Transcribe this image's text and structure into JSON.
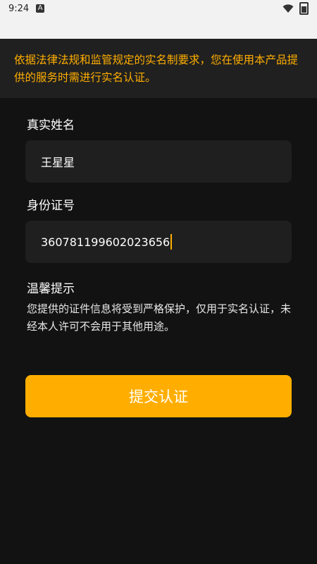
{
  "status_bar": {
    "time": "9:24",
    "notification_icon_letter": "A",
    "icons": [
      "wifi-icon",
      "battery-icon"
    ]
  },
  "notice": {
    "text": "依据法律法规和监管规定的实名制要求，您在使用本产品提供的服务时需进行实名认证。"
  },
  "form": {
    "name_label": "真实姓名",
    "name_value": "王星星",
    "id_label": "身份证号",
    "id_value": "360781199602023656"
  },
  "tips": {
    "title": "温馨提示",
    "text": "您提供的证件信息将受到严格保护，仅用于实名认证，未经本人许可不会用于其他用途。"
  },
  "submit": {
    "label": "提交认证"
  },
  "colors": {
    "accent": "#ffae00",
    "background": "#121212",
    "field_bg": "#1f1f1f"
  }
}
